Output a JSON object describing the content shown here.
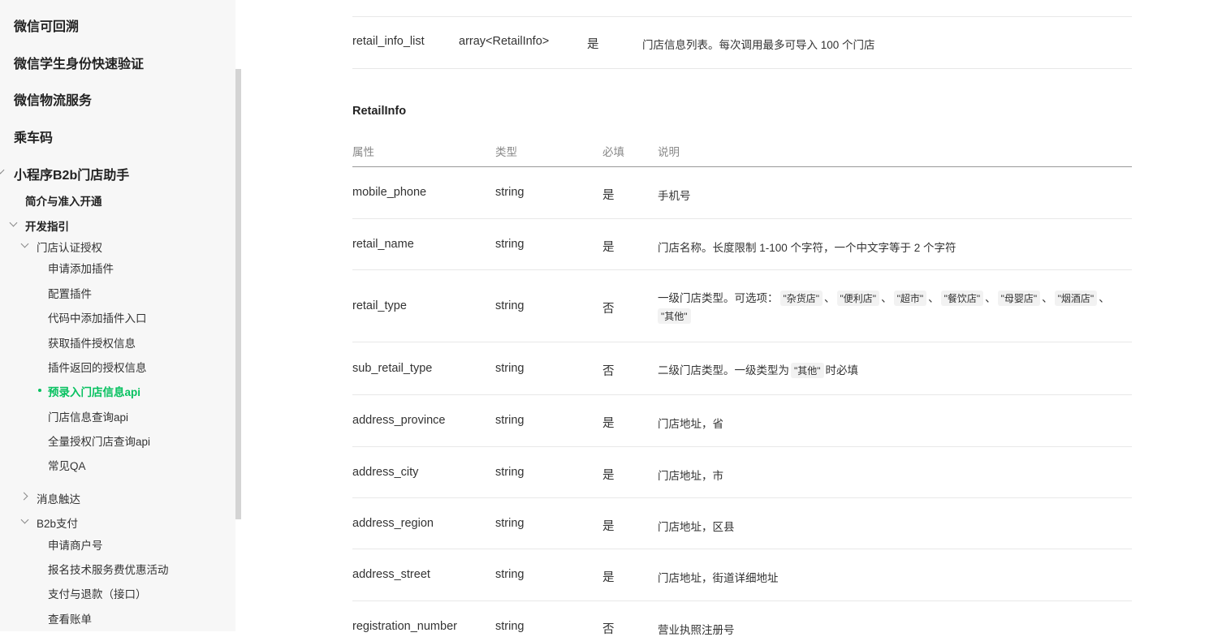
{
  "sidebar": {
    "top_items": [
      "微信可回溯",
      "微信学生身份快速验证",
      "微信物流服务",
      "乘车码",
      "小程序B2b门店助手"
    ],
    "intro": "简介与准入开通",
    "dev_guide": "开发指引",
    "store_auth": "门店认证授权",
    "store_auth_items": [
      "申请添加插件",
      "配置插件",
      "代码中添加插件入口",
      "获取插件授权信息",
      "插件返回的授权信息"
    ],
    "active_item": "预录入门店信息api",
    "store_auth_items_after": [
      "门店信息查询api",
      "全量授权门店查询api",
      "常见QA"
    ],
    "message": "消息触达",
    "b2b_pay": "B2b支付",
    "b2b_pay_items": [
      "申请商户号",
      "报名技术服务费优惠活动",
      "支付与退款（接口）",
      "查看账单"
    ]
  },
  "top_row": {
    "name": "retail_info_list",
    "type": "array<RetailInfo>",
    "required": "是",
    "desc": "门店信息列表。每次调用最多可导入 100 个门店"
  },
  "section_title": "RetailInfo",
  "table_headers": {
    "attr": "属性",
    "type": "类型",
    "required": "必填",
    "desc": "说明"
  },
  "rows": [
    {
      "name": "mobile_phone",
      "type": "string",
      "required": "是",
      "desc": "手机号"
    },
    {
      "name": "retail_name",
      "type": "string",
      "required": "是",
      "desc": "门店名称。长度限制 1-100 个字符，一个中文字等于 2 个字符"
    },
    {
      "name": "retail_type",
      "type": "string",
      "required": "否",
      "desc_prefix": "一级门店类型。可选项：",
      "options": [
        "\"杂货店\"",
        "\"便利店\"",
        "\"超市\"",
        "\"餐饮店\"",
        "\"母婴店\"",
        "\"烟酒店\""
      ],
      "option_last": "\"其他\"",
      "sep": "、"
    },
    {
      "name": "sub_retail_type",
      "type": "string",
      "required": "否",
      "desc_prefix": "二级门店类型。一级类型为",
      "code": "\"其他\"",
      "desc_suffix": "时必填"
    },
    {
      "name": "address_province",
      "type": "string",
      "required": "是",
      "desc": "门店地址，省"
    },
    {
      "name": "address_city",
      "type": "string",
      "required": "是",
      "desc": "门店地址，市"
    },
    {
      "name": "address_region",
      "type": "string",
      "required": "是",
      "desc": "门店地址，区县"
    },
    {
      "name": "address_street",
      "type": "string",
      "required": "是",
      "desc": "门店地址，街道详细地址"
    },
    {
      "name": "registration_number",
      "type": "string",
      "required": "否",
      "desc": "营业执照注册号"
    }
  ]
}
